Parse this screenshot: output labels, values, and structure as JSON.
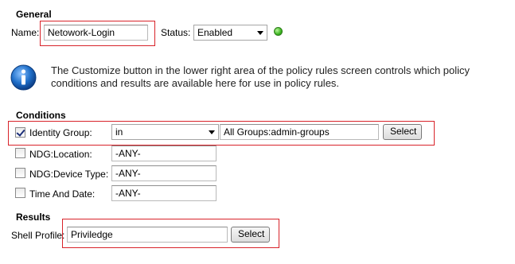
{
  "general": {
    "heading": "General",
    "name_label": "Name:",
    "name_value": "Netowork-Login",
    "status_label": "Status:",
    "status_value": "Enabled"
  },
  "info": {
    "icon": "info-icon",
    "line1": "The Customize button in the lower right area of the policy rules screen controls which policy",
    "line2": "conditions and results are available here for use in policy rules."
  },
  "conditions": {
    "heading": "Conditions",
    "rows": [
      {
        "label": "Identity Group:",
        "checked": true,
        "operator": "in",
        "value": "All Groups:admin-groups",
        "button": "Select"
      },
      {
        "label": "NDG:Location:",
        "checked": false,
        "value": "-ANY-"
      },
      {
        "label": "NDG:Device Type:",
        "checked": false,
        "value": "-ANY-"
      },
      {
        "label": "Time And Date:",
        "checked": false,
        "value": "-ANY-"
      }
    ]
  },
  "results": {
    "heading": "Results",
    "shell_profile_label": "Shell Profile:",
    "shell_profile_value": "Priviledge",
    "button": "Select"
  },
  "colors": {
    "highlight": "#d8232a",
    "status_ok": "#3cb521",
    "info_blue": "#1f6fc9"
  }
}
